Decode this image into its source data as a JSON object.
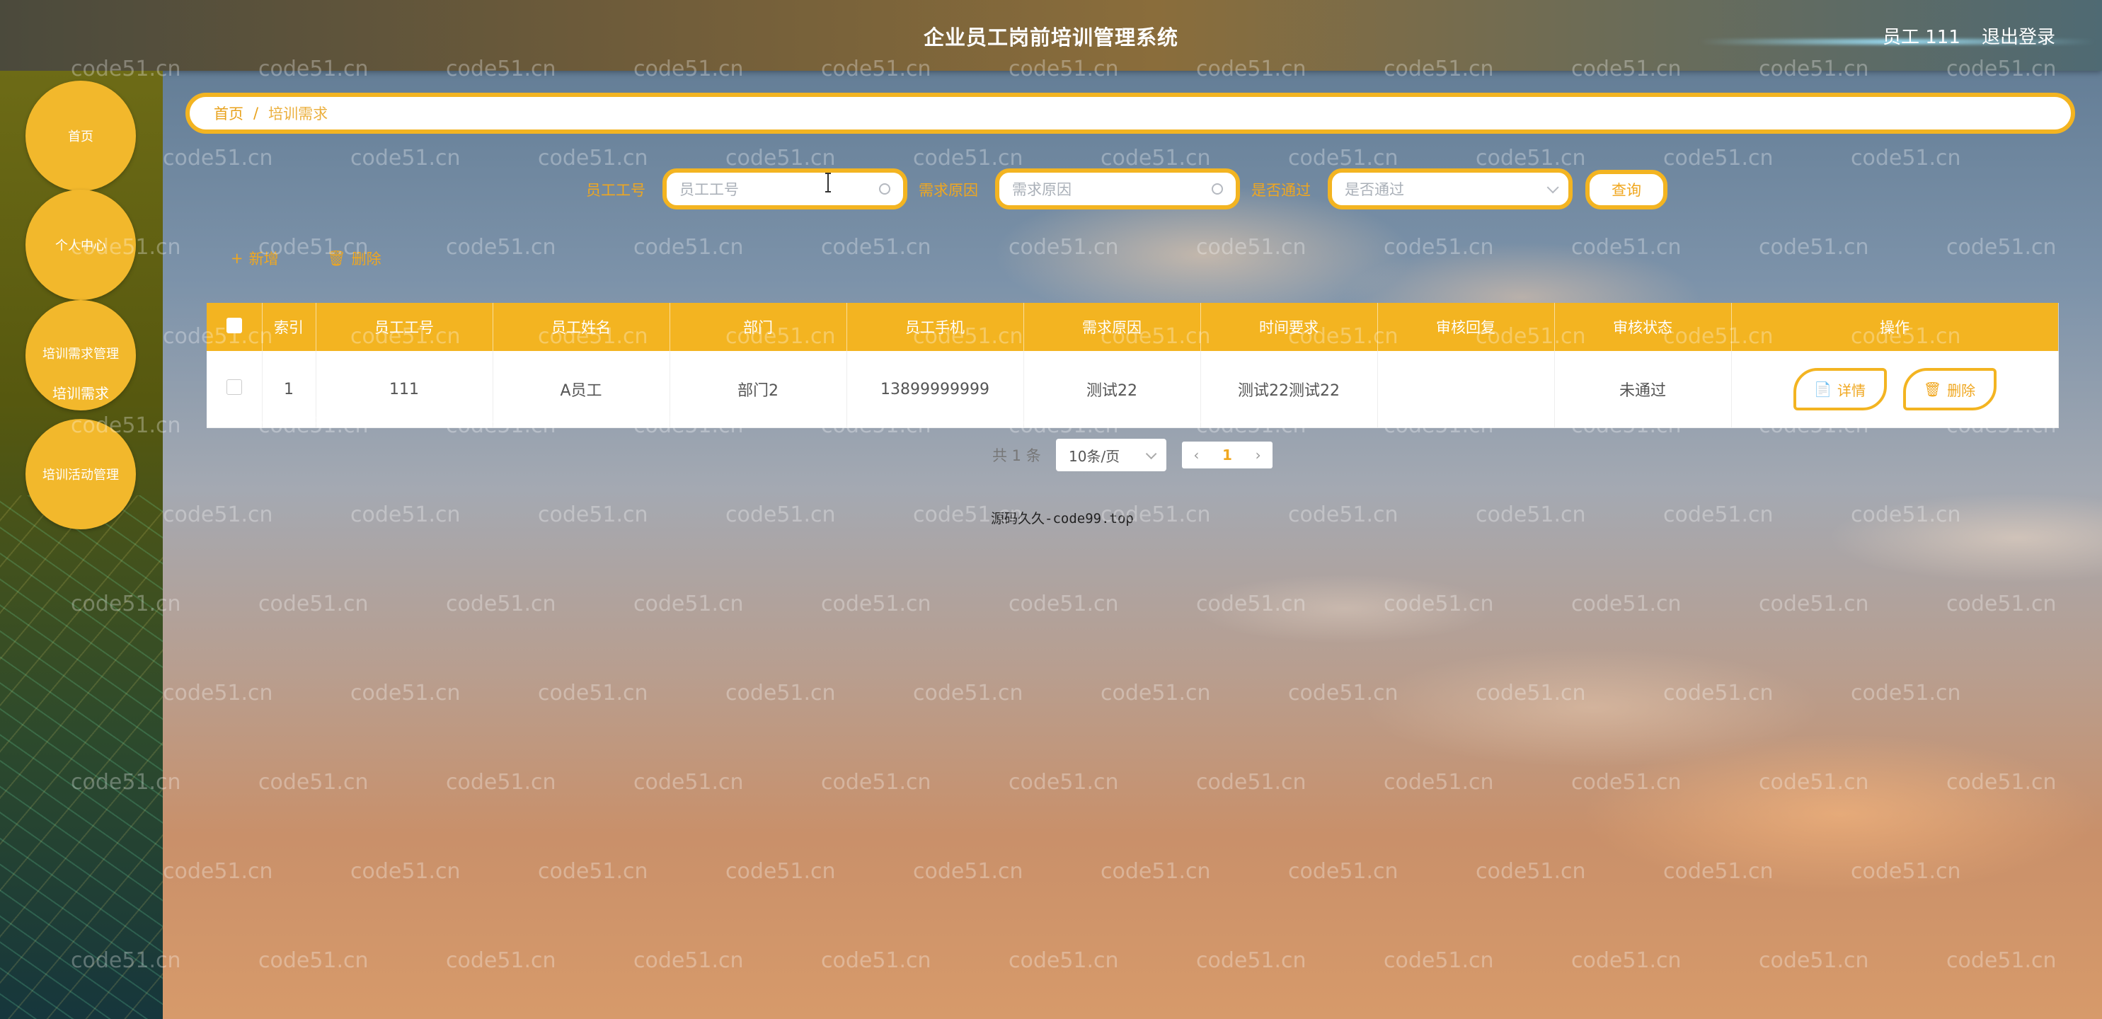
{
  "header": {
    "title": "企业员工岗前培训管理系统",
    "user": "员工 111",
    "logout": "退出登录"
  },
  "sidebar": {
    "items": [
      {
        "label": "首页"
      },
      {
        "label": "个人中心"
      },
      {
        "label": "培训需求管理"
      },
      {
        "label": "培训活动管理"
      }
    ],
    "sub_item": "培训需求"
  },
  "breadcrumb": {
    "home": "首页",
    "separator": "/",
    "current": "培训需求"
  },
  "search": {
    "employee_no": {
      "label": "员工工号",
      "placeholder": "员工工号"
    },
    "reason": {
      "label": "需求原因",
      "placeholder": "需求原因"
    },
    "approved": {
      "label": "是否通过",
      "placeholder": "是否通过"
    },
    "button": "查询"
  },
  "actions": {
    "add": "新增",
    "delete": "删除"
  },
  "table": {
    "columns": [
      "索引",
      "员工工号",
      "员工姓名",
      "部门",
      "员工手机",
      "需求原因",
      "时间要求",
      "审核回复",
      "审核状态",
      "操作"
    ],
    "rows": [
      {
        "index": "1",
        "employee_no": "111",
        "name": "A员工",
        "dept": "部门2",
        "phone": "13899999999",
        "reason": "测试22",
        "time_req": "测试22测试22",
        "reply": "",
        "status": "未通过",
        "detail_label": "详情",
        "delete_label": "删除"
      }
    ]
  },
  "pagination": {
    "total": "共 1 条",
    "page_size": "10条/页",
    "prev": "‹",
    "current": "1",
    "next": "›"
  },
  "footer": "源码久久-code99.top",
  "watermark": "code51.cn",
  "colors": {
    "accent": "#f3b421"
  }
}
